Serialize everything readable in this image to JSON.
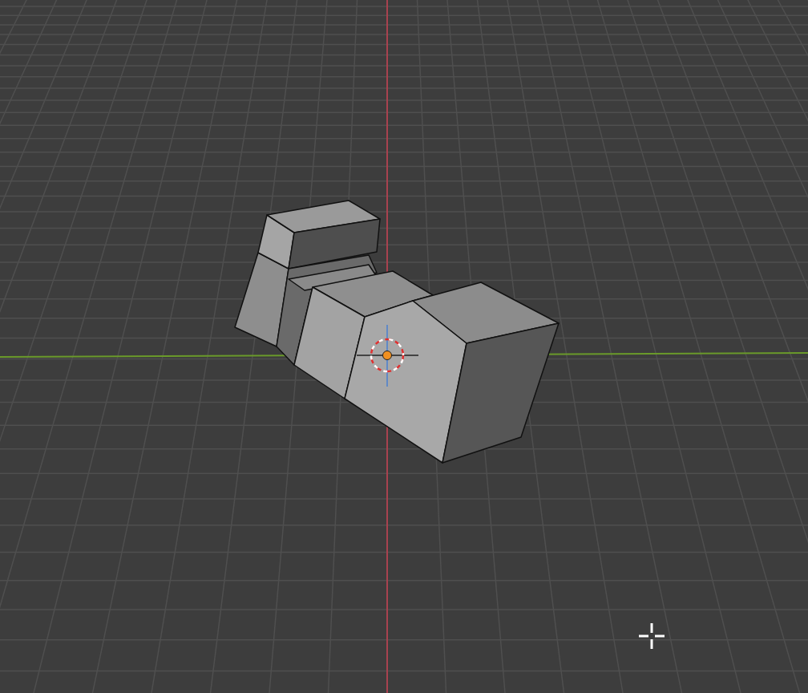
{
  "viewport": {
    "x_axis": true,
    "y_axis": true
  }
}
